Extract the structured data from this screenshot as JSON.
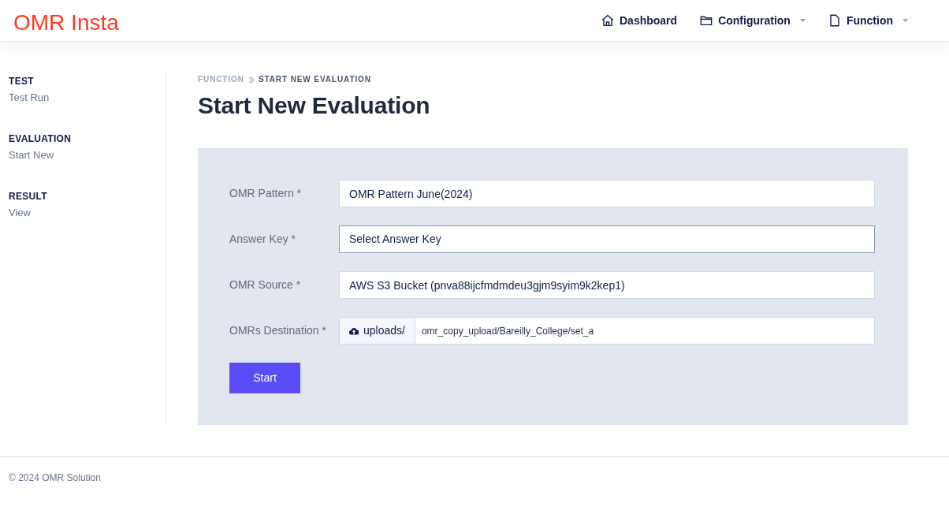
{
  "header": {
    "logo": "OMR Insta",
    "nav": [
      {
        "label": "Dashboard",
        "kind": "link"
      },
      {
        "label": "Configuration",
        "kind": "dropdown"
      },
      {
        "label": "Function",
        "kind": "dropdown"
      }
    ]
  },
  "sidebar": {
    "sections": [
      {
        "heading": "TEST",
        "items": [
          "Test Run"
        ]
      },
      {
        "heading": "EVALUATION",
        "items": [
          "Start New"
        ]
      },
      {
        "heading": "RESULT",
        "items": [
          "View"
        ]
      }
    ]
  },
  "breadcrumb": [
    {
      "label": "FUNCTION",
      "current": false
    },
    {
      "label": "START NEW EVALUATION",
      "current": true
    }
  ],
  "page_title": "Start New Evaluation",
  "form": {
    "fields": [
      {
        "label": "OMR Pattern *",
        "kind": "text",
        "value": "OMR Pattern June(2024)",
        "focused": false
      },
      {
        "label": "Answer Key *",
        "kind": "select",
        "value": "Select Answer Key",
        "focused": true
      },
      {
        "label": "OMR Source *",
        "kind": "text",
        "value": "AWS S3 Bucket (pnva88ijcfmdmdeu3gjm9syim9k2kep1)",
        "focused": false
      },
      {
        "label": "OMRs Destination *",
        "kind": "prefixed",
        "prefix": "uploads/",
        "value": "omr_copy_upload/Bareilly_College/set_a",
        "focused": false
      }
    ],
    "submit": "Start"
  },
  "footer": "© 2024 OMR Solution"
}
